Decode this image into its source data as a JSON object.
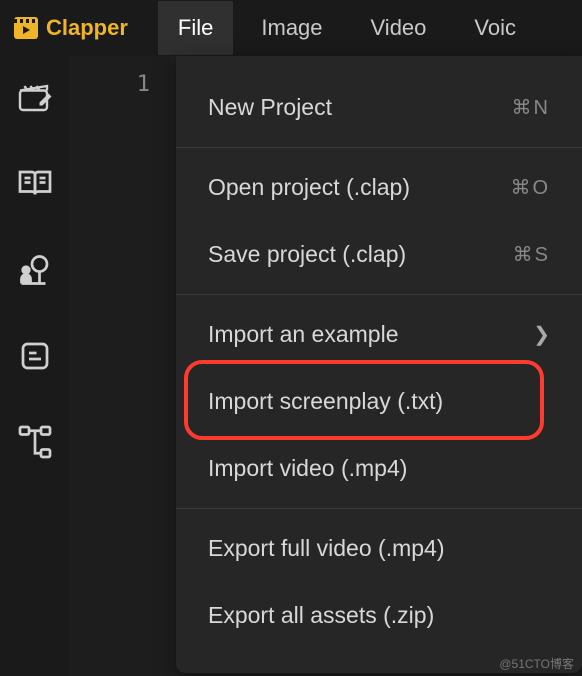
{
  "app": {
    "name": "Clapper"
  },
  "menubar": {
    "items": [
      {
        "label": "File",
        "active": true
      },
      {
        "label": "Image",
        "active": false
      },
      {
        "label": "Video",
        "active": false
      },
      {
        "label": "Voic",
        "active": false
      }
    ]
  },
  "sidebar": {
    "tools": [
      {
        "name": "clapper-edit-icon"
      },
      {
        "name": "book-open-icon"
      },
      {
        "name": "person-tree-icon"
      },
      {
        "name": "note-icon"
      },
      {
        "name": "sitemap-icon"
      }
    ]
  },
  "editor": {
    "line_number": "1"
  },
  "file_menu": {
    "groups": [
      [
        {
          "label": "New Project",
          "shortcut": "⌘N",
          "submenu": false,
          "highlighted": false
        }
      ],
      [
        {
          "label": "Open project (.clap)",
          "shortcut": "⌘O",
          "submenu": false,
          "highlighted": false
        },
        {
          "label": "Save project (.clap)",
          "shortcut": "⌘S",
          "submenu": false,
          "highlighted": false
        }
      ],
      [
        {
          "label": "Import an example",
          "shortcut": "",
          "submenu": true,
          "highlighted": true
        },
        {
          "label": "Import screenplay (.txt)",
          "shortcut": "",
          "submenu": false,
          "highlighted": false
        },
        {
          "label": "Import video (.mp4)",
          "shortcut": "",
          "submenu": false,
          "highlighted": false
        }
      ],
      [
        {
          "label": "Export full video (.mp4)",
          "shortcut": "",
          "submenu": false,
          "highlighted": false
        },
        {
          "label": "Export all assets (.zip)",
          "shortcut": "",
          "submenu": false,
          "highlighted": false
        }
      ]
    ]
  },
  "watermark": "@51CTO博客",
  "colors": {
    "accent": "#f0b429",
    "highlight": "#ff3b30"
  }
}
